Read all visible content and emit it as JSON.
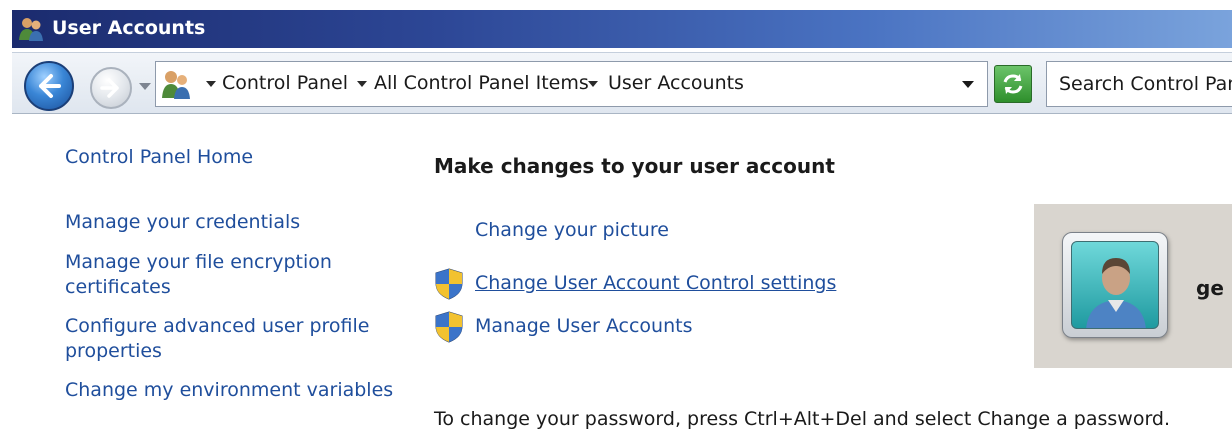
{
  "window": {
    "title": "User Accounts"
  },
  "navigation": {
    "breadcrumbs": [
      "Control Panel",
      "All Control Panel Items",
      "User Accounts"
    ],
    "search_placeholder": "Search Control Panel"
  },
  "sidebar": {
    "items": [
      {
        "label": "Control Panel Home"
      },
      {
        "label": "Manage your credentials"
      },
      {
        "label": "Manage your file encryption certificates"
      },
      {
        "label": "Configure advanced user profile properties"
      },
      {
        "label": "Change my environment variables"
      }
    ]
  },
  "main": {
    "heading": "Make changes to your user account",
    "tasks": [
      {
        "label": "Change your picture",
        "icon": "none"
      },
      {
        "label": "Change User Account Control settings",
        "icon": "uac-shield-icon"
      },
      {
        "label": "Manage User Accounts",
        "icon": "uac-shield-icon"
      }
    ],
    "password_note": "To change your password, press Ctrl+Alt+Del and select Change a password."
  },
  "user_tile": {
    "name": "ge"
  },
  "colors": {
    "link": "#1f4e9c",
    "title_bar": "#2d4796",
    "tile_background": "#d9d5cf"
  }
}
